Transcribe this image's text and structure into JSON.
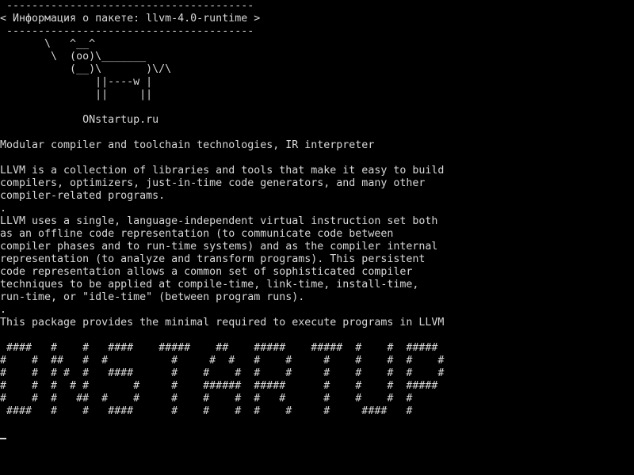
{
  "terminal": {
    "text_color": "#d8d8d8",
    "background": "#000000",
    "cowsay": {
      "border_top": " ---------------------------------------",
      "bubble_text": "< Информация о пакете: llvm-4.0-runtime >",
      "border_bottom": " ---------------------------------------",
      "cow_line_1": "       \\   ^__^",
      "cow_line_2": "        \\  (oo)\\_______",
      "cow_line_3": "           (__)\\       )\\/\\",
      "cow_line_4": "               ||----w |",
      "cow_line_5": "               ||     ||"
    },
    "site": "             ONstartup.ru",
    "summary": "Modular compiler and toolchain technologies, IR interpreter",
    "description_lines": [
      "LLVM is a collection of libraries and tools that make it easy to build",
      "compilers, optimizers, just-in-time code generators, and many other",
      "compiler-related programs.",
      ".",
      "LLVM uses a single, language-independent virtual instruction set both",
      "as an offline code representation (to communicate code between",
      "compiler phases and to run-time systems) and as the compiler internal",
      "representation (to analyze and transform programs). This persistent",
      "code representation allows a common set of sophisticated compiler",
      "techniques to be applied at compile-time, link-time, install-time,",
      "run-time, or \"idle-time\" (between program runs).",
      ".",
      "This package provides the minimal required to execute programs in LLVM"
    ],
    "banner_lines": [
      " ####   #    #   ####    #####    ##    #####    #####  #    #  #####",
      "#    #  ##   #  #          #     #  #   #    #     #    #    #  #    #",
      "#    #  # #  #   ####      #    #    #  #    #     #    #    #  #    #",
      "#    #  #  # #       #     #    ######  #####      #    #    #  #####",
      "#    #  #   ##  #    #     #    #    #  #   #      #    #    #  #",
      " ####   #    #   ####      #    #    #  #    #     #     ####   #"
    ]
  }
}
